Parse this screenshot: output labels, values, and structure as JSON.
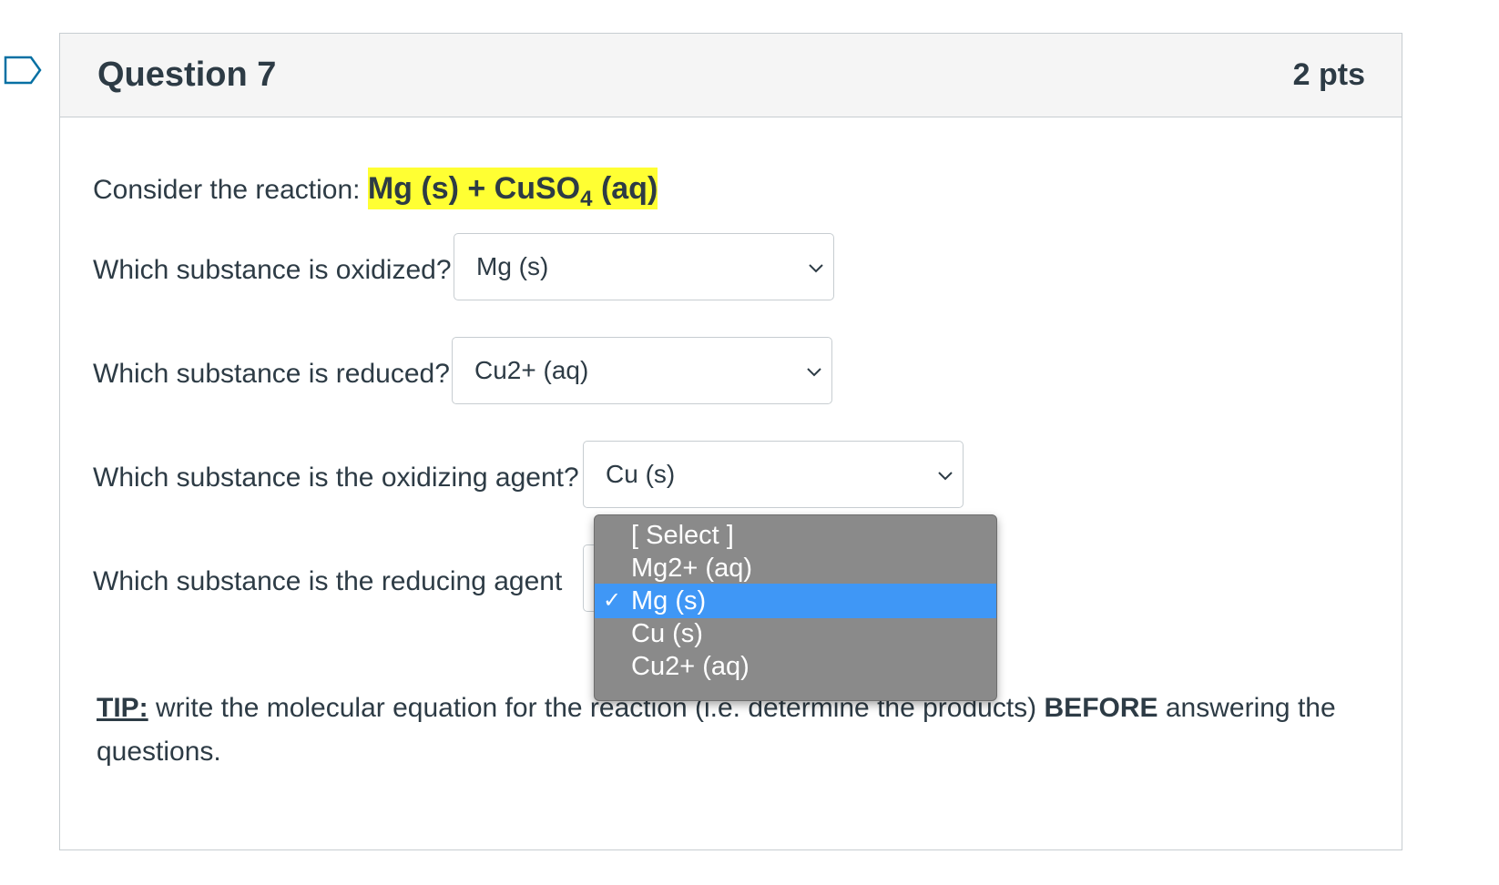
{
  "question": {
    "title": "Question 7",
    "points": "2 pts",
    "prompt_prefix": "Consider the reaction: ",
    "reaction_left": "Mg (s) + CuSO",
    "reaction_sub": "4",
    "reaction_right": " (aq)"
  },
  "rows": [
    {
      "label": "Which substance is oxidized?",
      "selected": "Mg (s)"
    },
    {
      "label": "Which substance is reduced?",
      "selected": "Cu2+ (aq)"
    },
    {
      "label": "Which substance is the oxidizing agent?",
      "selected": "Cu (s)"
    },
    {
      "label": "Which substance is the reducing agent"
    }
  ],
  "dropdown": {
    "check": "✓",
    "options": [
      "[ Select ]",
      "Mg2+ (aq)",
      "Mg (s)",
      "Cu (s)",
      "Cu2+ (aq)"
    ]
  },
  "tip": {
    "label": "TIP:",
    "text1": " write the molecular equation for the reaction (i.e. determine the products) ",
    "bold": "BEFORE",
    "text2": " answering the questions."
  },
  "colors": {
    "highlight": "#ffff33",
    "dropdown_bg": "#8a8a8a",
    "selected_option": "#3f97f6"
  }
}
